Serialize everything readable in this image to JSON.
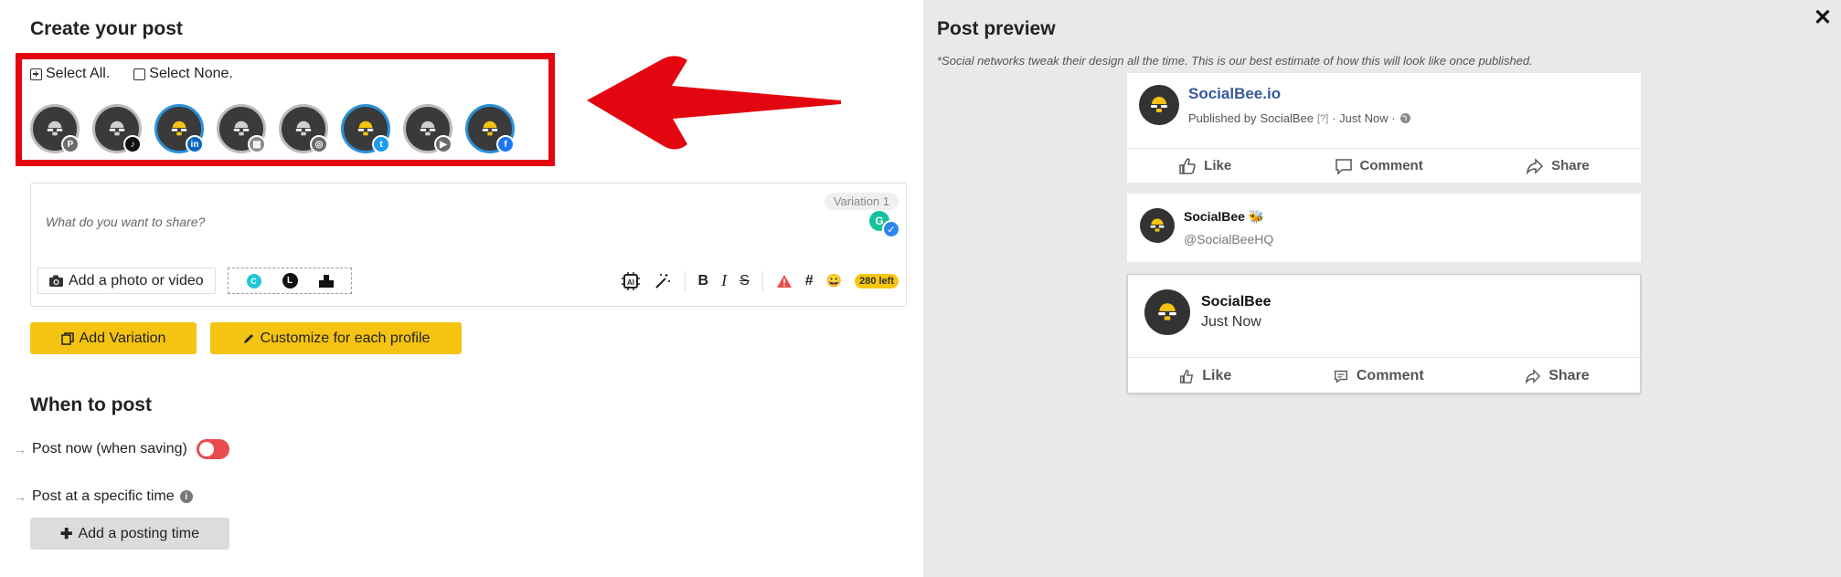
{
  "editor_panel": {
    "title": "Create your post",
    "select_all": "Select All.",
    "select_none": "Select None.",
    "profiles": [
      {
        "network": "pinterest",
        "badge": "P",
        "badge_color": "#6b6b6b",
        "active": false
      },
      {
        "network": "tiktok",
        "badge": "♪",
        "badge_color": "#111111",
        "active": false
      },
      {
        "network": "linkedin",
        "badge": "in",
        "badge_color": "#0a66c2",
        "active": true
      },
      {
        "network": "google-business",
        "badge": "▦",
        "badge_color": "#8a8a8a",
        "active": false
      },
      {
        "network": "instagram",
        "badge": "◎",
        "badge_color": "#6b6b6b",
        "active": false
      },
      {
        "network": "twitter",
        "badge": "t",
        "badge_color": "#1d9bf0",
        "active": true
      },
      {
        "network": "youtube",
        "badge": "▶",
        "badge_color": "#6b6b6b",
        "active": false
      },
      {
        "network": "facebook",
        "badge": "f",
        "badge_color": "#1877f2",
        "active": true
      }
    ],
    "variation_tag": "Variation 1",
    "placeholder": "What do you want to share?",
    "add_photo": "Add a photo or video",
    "chars_left": "280 left",
    "add_variation": "Add Variation",
    "customize": "Customize for each profile"
  },
  "when_to_post": {
    "title": "When to post",
    "post_now": "Post now (when saving)",
    "post_specific": "Post at a specific time",
    "add_time": "Add a posting time"
  },
  "preview": {
    "title": "Post preview",
    "note": "*Social networks tweak their design all the time. This is our best estimate of how this will look like once published.",
    "facebook": {
      "page_name": "SocialBee.io",
      "published_by_label": "Published by",
      "published_by": "SocialBee",
      "help": "[?]",
      "time": "· Just Now ·",
      "like": "Like",
      "comment": "Comment",
      "share": "Share"
    },
    "twitter": {
      "name": "SocialBee 🐝",
      "handle": "@SocialBeeHQ"
    },
    "linkedin": {
      "name": "SocialBee",
      "time": "Just Now",
      "like": "Like",
      "comment": "Comment",
      "share": "Share"
    }
  },
  "colors": {
    "accent_yellow": "#f5c311",
    "highlight_red": "#e3050f",
    "toggle_off_red": "#e84d4d",
    "facebook_blue": "#385898"
  }
}
